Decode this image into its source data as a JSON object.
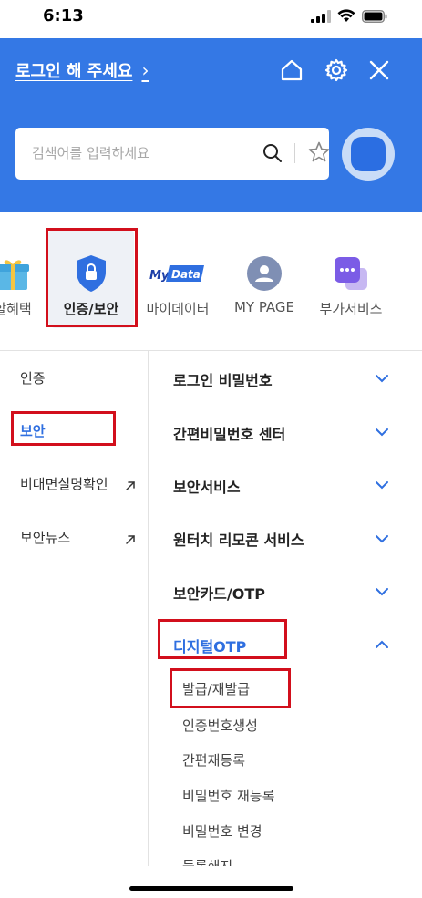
{
  "status": {
    "time": "6:13"
  },
  "header": {
    "login_label": "로그인 해 주세요",
    "login_chevron": "›",
    "icons": [
      "home-icon",
      "gear-icon",
      "close-icon"
    ]
  },
  "search": {
    "placeholder": "검색어를 입력하세요"
  },
  "categories": [
    {
      "label": "할혜택",
      "icon": "gift-icon"
    },
    {
      "label": "인증/보안",
      "icon": "shield-lock-icon",
      "selected": true
    },
    {
      "label": "마이데이터",
      "icon": "mydata-logo-icon",
      "logo_text": [
        "My",
        "Data"
      ]
    },
    {
      "label": "MY PAGE",
      "icon": "person-icon"
    },
    {
      "label": "부가서비스",
      "icon": "more-services-icon"
    }
  ],
  "left_menu": [
    {
      "label": "인증"
    },
    {
      "label": "보안",
      "active": true
    },
    {
      "label": "비대면실명확인",
      "external": true
    },
    {
      "label": "보안뉴스",
      "external": true
    }
  ],
  "right_menu": [
    {
      "label": "로그인 비밀번호"
    },
    {
      "label": "간편비밀번호 센터"
    },
    {
      "label": "보안서비스"
    },
    {
      "label": "원터치 리모콘 서비스"
    },
    {
      "label": "보안카드/OTP"
    },
    {
      "label": "디지털OTP",
      "expanded": true
    }
  ],
  "sub_menu": [
    {
      "label": "발급/재발급"
    },
    {
      "label": "인증번호생성"
    },
    {
      "label": "간편재등록"
    },
    {
      "label": "비밀번호 재등록"
    },
    {
      "label": "비밀번호 변경"
    },
    {
      "label": "등록해지"
    }
  ],
  "colors": {
    "header_blue": "#3478e5",
    "active_blue": "#2f6fe0",
    "highlight_red": "#d20f1c"
  }
}
